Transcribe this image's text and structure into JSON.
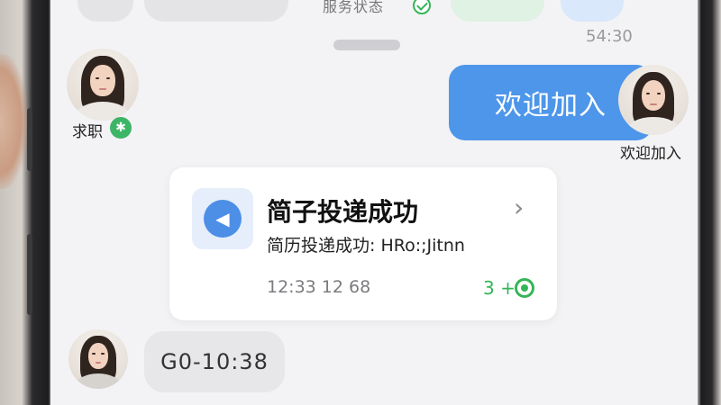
{
  "chat": {
    "top_partial_text": "服务状态",
    "timestamp_top": "54:30",
    "left_user": {
      "label": "求职",
      "badge_icon": "gear-icon"
    },
    "right_user": {
      "label": "欢迎加入"
    },
    "outgoing_message": "欢迎加入",
    "card": {
      "icon": "speaker-icon",
      "title": "简子投递成功",
      "subtitle": "简历投递成功: HRo:;Jitnn",
      "time": "12:33 12 68",
      "count": "3 +",
      "status_icon": "radio-dot-icon"
    },
    "incoming_message": "G0-10:38"
  },
  "colors": {
    "accent_blue": "#4d96ea",
    "success_green": "#35b558",
    "background": "#f3f3f5"
  }
}
